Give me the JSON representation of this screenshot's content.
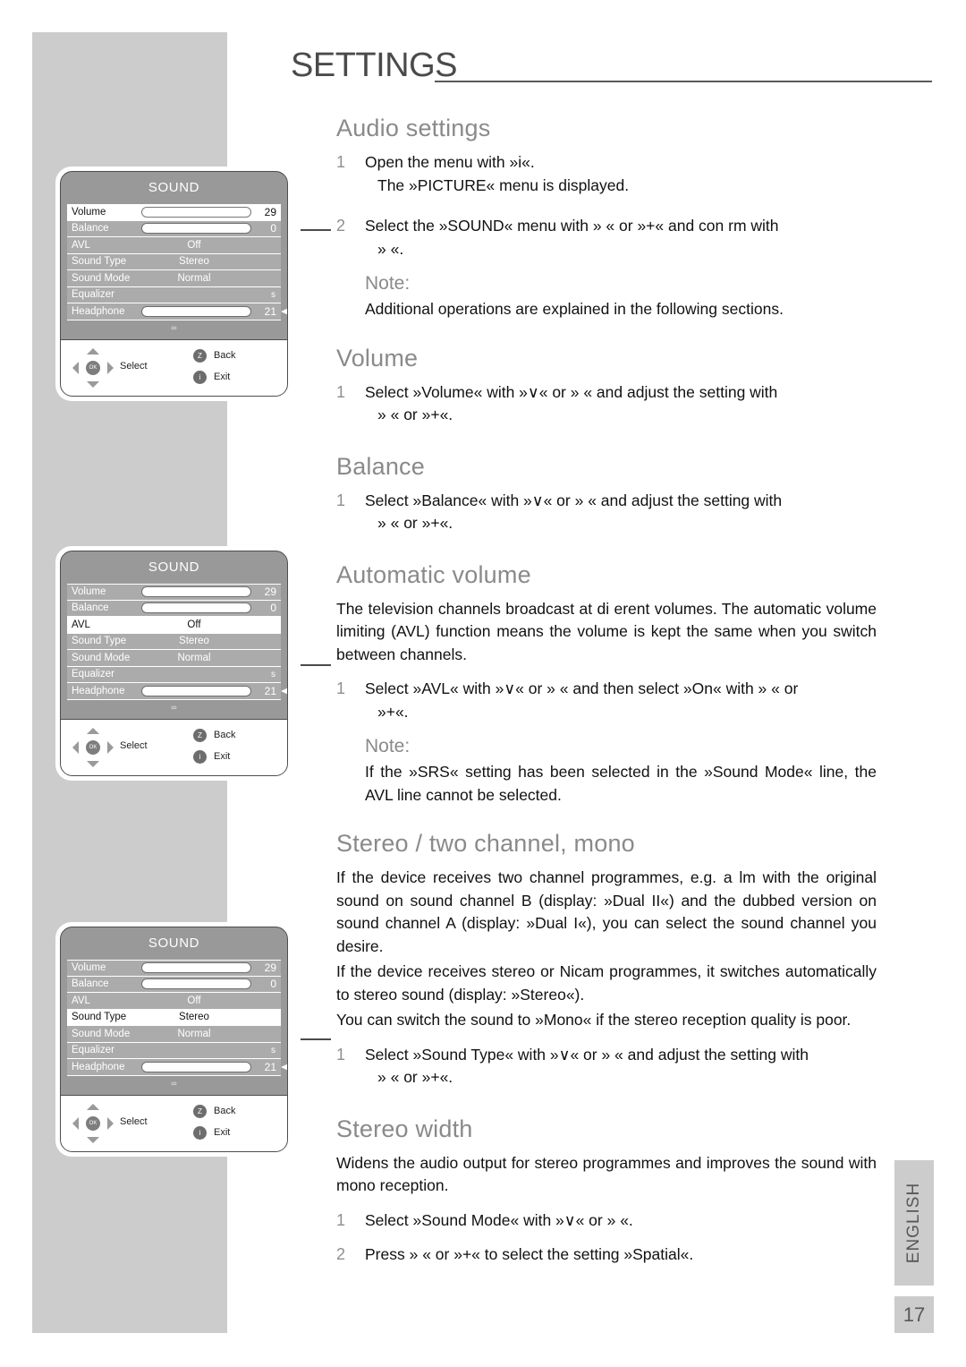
{
  "page": {
    "title": "SETTINGS",
    "language_tab": "ENGLISH",
    "number": "17"
  },
  "sections": {
    "audio": {
      "heading": "Audio settings",
      "step1_num": "1",
      "step1": "Open the menu with »i«.",
      "step1_sub": "The »PICTURE« menu is displayed.",
      "step2_num": "2",
      "step2": "Select the »SOUND« menu with »   « or »+« and con rm with",
      "step2_sub": "»   «.",
      "note_label": "Note:",
      "note": "Additional operations are explained in the following sections."
    },
    "volume": {
      "heading": "Volume",
      "step1_num": "1",
      "step1": "Select »Volume« with »∨« or »   « and adjust the setting with",
      "step1_sub": "»   « or »+«."
    },
    "balance": {
      "heading": "Balance",
      "step1_num": "1",
      "step1": "Select »Balance« with »∨« or »   « and adjust the setting with",
      "step1_sub": "»   « or »+«."
    },
    "automatic_volume": {
      "heading": "Automatic volume",
      "para1": "The television channels broadcast at di erent volumes. The automatic volume limiting (AVL) function means the volume is kept the same when you switch between channels.",
      "step1_num": "1",
      "step1": "Select »AVL« with »∨« or »   « and then select »On« with »   « or",
      "step1_sub": "»+«.",
      "note_label": "Note:",
      "note": "If the »SRS« setting has been selected in the »Sound Mode« line, the AVL line cannot be selected."
    },
    "stereo_two_channel": {
      "heading": "Stereo / two channel, mono",
      "para1": "If the device receives two channel programmes, e.g. a  lm with the original sound on sound channel B (display: »Dual II«) and the dubbed version on sound channel A (display: »Dual I«), you can select the sound channel you desire.",
      "para2": "If the device receives stereo or Nicam programmes, it switches automatically to stereo sound (display: »Stereo«).",
      "para3": "You can switch the sound to »Mono« if the stereo reception quality is poor.",
      "step1_num": "1",
      "step1": "Select »Sound Type« with »∨« or »   « and adjust the setting with",
      "step1_sub": "»   « or »+«."
    },
    "stereo_width": {
      "heading": "Stereo width",
      "para1": "Widens the audio output for stereo programmes and improves the sound with mono reception.",
      "step1_num": "1",
      "step1": "Select »Sound Mode« with »∨« or »   «.",
      "step2_num": "2",
      "step2": "Press »   « or »+« to select the setting »Spatial«."
    }
  },
  "osd": {
    "title": "SOUND",
    "rows": [
      {
        "label": "Volume",
        "type": "slider",
        "value": "29"
      },
      {
        "label": "Balance",
        "type": "slider",
        "value": "0"
      },
      {
        "label": "AVL",
        "type": "center",
        "value": "Off"
      },
      {
        "label": "Sound Type",
        "type": "center",
        "value": "Stereo"
      },
      {
        "label": "Sound Mode",
        "type": "center",
        "value": "Normal"
      },
      {
        "label": "Equalizer",
        "type": "right",
        "value": "s"
      },
      {
        "label": "Headphone",
        "type": "slider",
        "value": "21"
      }
    ],
    "footer_symbol": "∞",
    "nav": {
      "select": "Select",
      "back_key": "Z",
      "back": "Back",
      "exit_key": "i",
      "exit": "Exit",
      "ok": "OK"
    },
    "selected": [
      "Volume",
      "AVL",
      "Sound Type"
    ]
  }
}
